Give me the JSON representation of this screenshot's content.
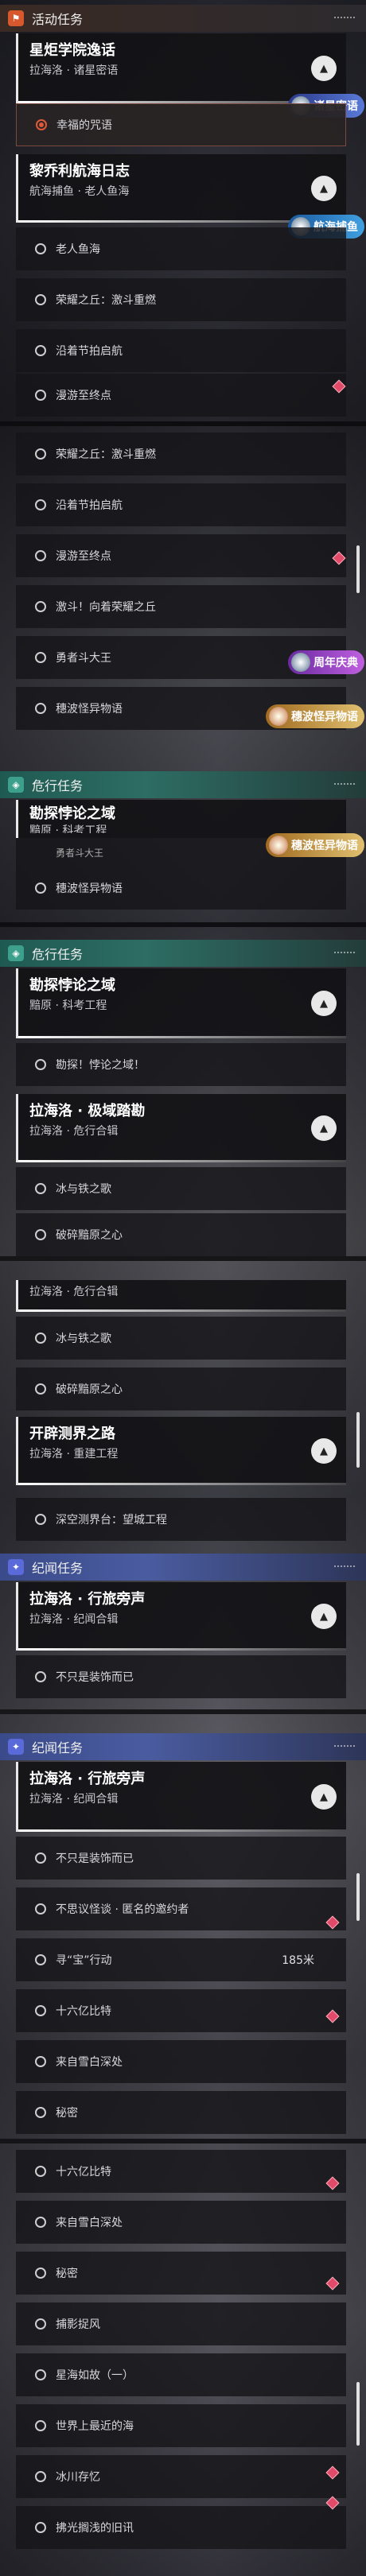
{
  "activity": {
    "header": "活动任务",
    "card1": {
      "title": "星炬学院逸话",
      "sub": "拉海洛 · 诸星密语",
      "badge": "诸星密语"
    },
    "active_item": "幸福的咒语",
    "card2": {
      "title": "黎乔利航海日志",
      "sub": "航海捕鱼 · 老人鱼海",
      "badge": "航海捕鱼"
    },
    "items_a": [
      "老人鱼海",
      "荣耀之丘：激斗重燃",
      "沿着节拍启航",
      "漫游至终点"
    ],
    "items_b": [
      "荣耀之丘：激斗重燃",
      "沿着节拍启航",
      "漫游至终点",
      "激斗！向着荣耀之丘",
      "勇者斗大王",
      "穗波怪异物语"
    ],
    "badge_anniv": "周年庆典",
    "badge_suiha": "穗波怪异物语"
  },
  "danger": {
    "header": "危行任务",
    "card1": {
      "title": "勘探悖论之域",
      "sub": "黯原 · 科考工程"
    },
    "peek_sub": "黯原 · 科考工程",
    "peek_item": "勇者斗大王",
    "peek_item2": "穗波怪异物语",
    "item1": "勘探！悖论之域！",
    "card2": {
      "title": "拉海洛 · 极域踏勘",
      "sub": "拉海洛 · 危行合辑"
    },
    "items": [
      "冰与铁之歌",
      "破碎黯原之心"
    ],
    "card2b_sub": "拉海洛 · 危行合辑",
    "card3": {
      "title": "开辟测界之路",
      "sub": "拉海洛 · 重建工程"
    },
    "item3": "深空测界台：望城工程"
  },
  "legend": {
    "header": "纪闻任务",
    "card1": {
      "title": "拉海洛 · 行旅旁声",
      "sub": "拉海洛 · 纪闻合辑"
    },
    "item1": "不只是装饰而已",
    "items": [
      "不只是装饰而已",
      "不思议怪谈 · 匿名的邀约者",
      "寻“宝”行动",
      "十六亿比特",
      "来自雪白深处",
      "秘密"
    ],
    "distance": "185米",
    "items2": [
      "十六亿比特",
      "来自雪白深处",
      "秘密",
      "捕影捉风",
      "星海如故（一）",
      "世界上最近的海",
      "冰川存忆",
      "拂光搁浅的旧讯"
    ]
  },
  "icons": {
    "activity": "flag-icon",
    "danger": "hazard-icon",
    "legend": "star-icon",
    "toggle": "chevron-up-icon",
    "marker": "diamond-marker-icon"
  }
}
